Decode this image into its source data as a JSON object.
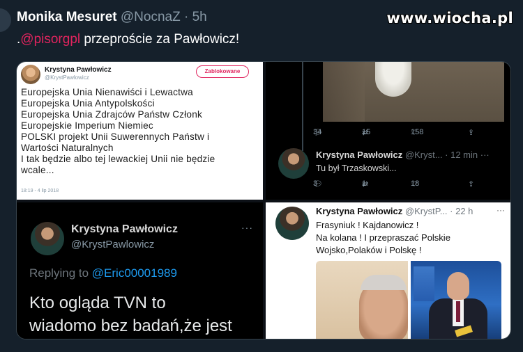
{
  "tweet": {
    "author": "Monika Mesuret",
    "handle": "@NocnaZ",
    "time": "· 5h",
    "text_prefix": ".",
    "mention": "@pisorgpl",
    "text_rest": " przeproście za Pawłowicz!"
  },
  "watermark": "www.wiocha.pl",
  "panel1": {
    "name": "Krystyna Pawłowicz",
    "handle": "@KrystPawlowicz",
    "blocked_label": "Zablokowane",
    "lines": [
      "Europejska Unia Nienawiści i Lewactwa",
      "Europejska Unia Antypolskości",
      "Europejska Unia Zdrajców Państw Członk",
      "Europejskie Imperium Niemiec",
      "POLSKI projekt Unii Suwerennych Państw i",
      "Wartości Naturalnych",
      "I  tak będzie albo tej lewackiej Unii nie będzie",
      "wcale..."
    ],
    "date": "18:19 - 4 lip 2018"
  },
  "panel2": {
    "top_counts": {
      "replies": "34",
      "retweets": "15",
      "likes": "158"
    },
    "name": "Krystyna Pawłowicz",
    "handle_time": "@Kryst... · 12 min",
    "dots": "···",
    "text": "Tu był Trzaskowski...",
    "bottom_counts": {
      "replies": "3",
      "retweets": "1",
      "likes": "18"
    }
  },
  "panel3": {
    "name": "Krystyna Pawłowicz",
    "handle": "@KrystPawlowicz",
    "dots": "···",
    "replying_label": "Replying to ",
    "replying_to": "@Eric00001989",
    "lines": [
      "Kto ogląda TVN to",
      "wiadomo bez badań,że jest"
    ]
  },
  "panel4": {
    "name": "Krystyna Pawłowicz",
    "handle_time": "@KrystP... · 22 h",
    "dots": "···",
    "lines": [
      "Frasyniuk !  Kajdanowicz !",
      "Na kolana !  I przepraszać Polskie",
      "Wojsko,Polaków i Polskę !"
    ]
  },
  "icons": {
    "reply": "reply-icon",
    "retweet": "retweet-icon",
    "like": "heart-icon",
    "share": "share-icon"
  }
}
